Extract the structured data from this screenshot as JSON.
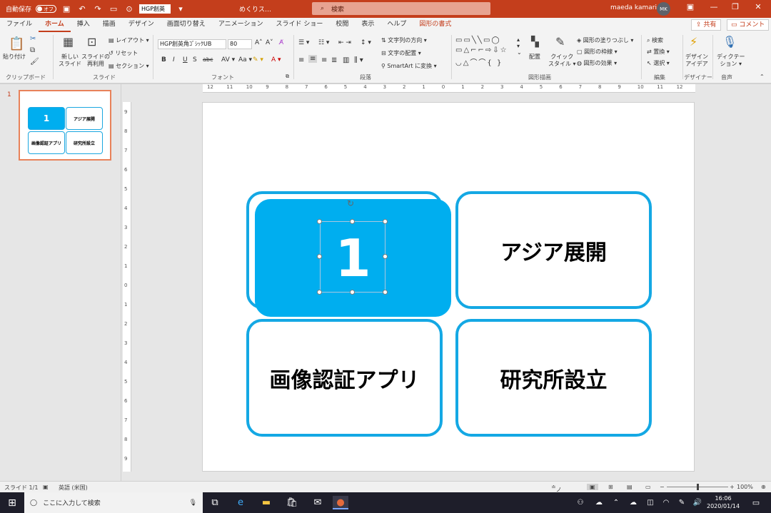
{
  "titlebar": {
    "autosave_label": "自動保存",
    "autosave_state": "オフ",
    "font_box": "HGP創英",
    "doc_title": "めくりス…",
    "search_placeholder": "検索",
    "user_name": "maeda kamari",
    "user_initials": "MK"
  },
  "tabs": [
    "ファイル",
    "ホーム",
    "挿入",
    "描画",
    "デザイン",
    "画面切り替え",
    "アニメーション",
    "スライド ショー",
    "校閲",
    "表示",
    "ヘルプ",
    "図形の書式"
  ],
  "active_tab": "ホーム",
  "share_label": "共有",
  "comment_label": "コメント",
  "ribbon": {
    "clipboard": {
      "paste": "貼り付け",
      "label": "クリップボード"
    },
    "slides": {
      "new_slide_1": "新しい",
      "new_slide_2": "スライド",
      "reuse_1": "スライドの",
      "reuse_2": "再利用",
      "layout": "レイアウト",
      "reset": "リセット",
      "section": "セクション",
      "label": "スライド"
    },
    "font": {
      "name": "HGP創英角ｺﾞｼｯｸUB",
      "size": "80",
      "bold": "B",
      "italic": "I",
      "underline": "U",
      "strike": "S",
      "shadow": "abc",
      "label": "フォント"
    },
    "paragraph": {
      "text_direction": "文字列の方向",
      "align_text": "文字の配置",
      "smartart": "SmartArt に変換",
      "label": "段落"
    },
    "drawing": {
      "arrange": "配置",
      "quick_styles_1": "クイック",
      "quick_styles_2": "スタイル",
      "shape_fill": "図形の塗りつぶし",
      "shape_outline": "図形の枠線",
      "shape_effects": "図形の効果",
      "label": "図形描画"
    },
    "editing": {
      "find": "検索",
      "replace": "置換",
      "select": "選択",
      "label": "編集"
    },
    "designer": {
      "ideas_1": "デザイン",
      "ideas_2": "アイデア",
      "label": "デザイナー"
    },
    "voice": {
      "dictate_1": "ディクテー",
      "dictate_2": "ション",
      "label": "音声"
    }
  },
  "thumbnail": {
    "number": "1",
    "boxes": [
      "1",
      "アジア展開",
      "画像認証アプリ",
      "研究所設立"
    ]
  },
  "hruler_ticks": [
    "12",
    "11",
    "10",
    "9",
    "8",
    "7",
    "6",
    "5",
    "4",
    "3",
    "2",
    "1",
    "0",
    "1",
    "2",
    "3",
    "4",
    "5",
    "6",
    "7",
    "8",
    "9",
    "10",
    "11",
    "12"
  ],
  "vruler_ticks": [
    "9",
    "8",
    "7",
    "6",
    "5",
    "4",
    "3",
    "2",
    "1",
    "0",
    "1",
    "2",
    "3",
    "4",
    "5",
    "6",
    "7",
    "8",
    "9"
  ],
  "slide": {
    "card_number": "1",
    "card_asia": "アジア展開",
    "card_app": "画像認証アプリ",
    "card_lab": "研究所設立"
  },
  "status": {
    "slide_count": "スライド 1/1",
    "language": "英語 (米国)",
    "notes": "ノート",
    "zoom": "100%"
  },
  "taskbar": {
    "search_placeholder": "ここに入力して検索",
    "time": "16:06",
    "date": "2020/01/14"
  }
}
